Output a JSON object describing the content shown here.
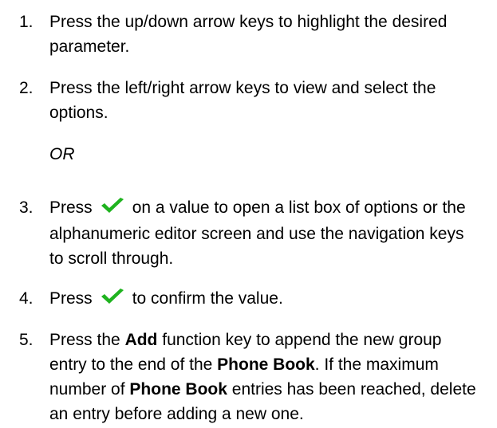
{
  "steps": [
    {
      "number": "1.",
      "text": "Press the up/down arrow keys to highlight the desired parameter."
    },
    {
      "number": "2.",
      "text": "Press the left/right arrow keys to view and select the options."
    },
    {
      "or_label": "OR"
    },
    {
      "number": "3.",
      "prefix": "Press",
      "suffix": "on a value to open a list box of options or the alphanumeric editor screen and use the navigation keys to scroll through."
    },
    {
      "number": "4.",
      "prefix": "Press",
      "suffix": "to confirm the value."
    },
    {
      "number": "5.",
      "part1": "Press the",
      "add": "Add",
      "part2": "function key to append the new group entry to the end of the",
      "phone_book": "Phone Book",
      "part3": ". If the maximum number of",
      "part4": "entries has been reached, delete an entry before adding a new one."
    }
  ],
  "icons": {
    "confirm": "check-icon",
    "confirm_color": "#1fb31f"
  }
}
